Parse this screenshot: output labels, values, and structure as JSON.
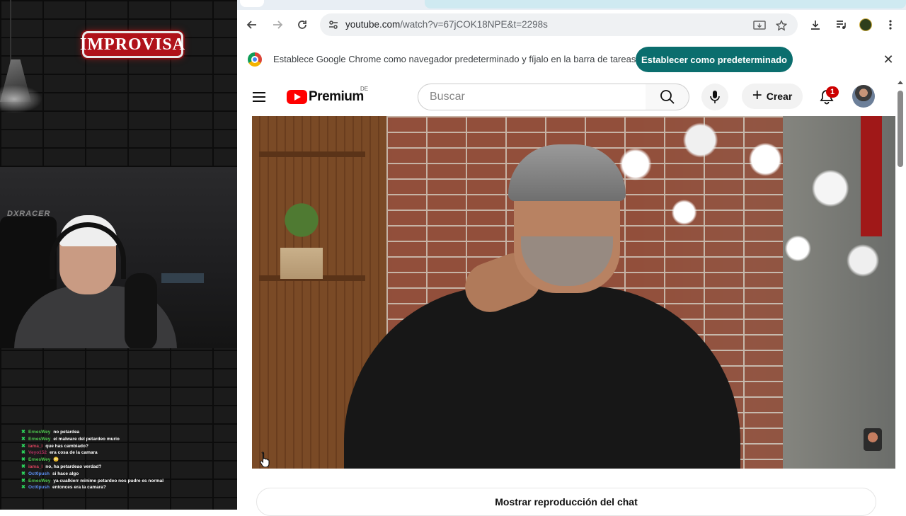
{
  "stream": {
    "brand_sign": "IMPROVISA",
    "chair_brand": "DXRACER",
    "chat": [
      {
        "user": "ErnesWey",
        "user_color": "#4ec94e",
        "text": "no petardea"
      },
      {
        "user": "ErnesWey",
        "user_color": "#4ec94e",
        "text": "el malware del petardeo murio"
      },
      {
        "user": "iama_l",
        "user_color": "#d4425b",
        "text": "que has cambiado?"
      },
      {
        "user": "Veyo152",
        "user_color": "#b03060",
        "text": "era cosa de la camara"
      },
      {
        "user": "ErnesWey",
        "user_color": "#4ec94e",
        "text": "😳"
      },
      {
        "user": "iama_l",
        "user_color": "#d4425b",
        "text": "no, ha petardeao verdad?"
      },
      {
        "user": "Oct0push",
        "user_color": "#5a8dee",
        "text": "si hace algo"
      },
      {
        "user": "ErnesWey",
        "user_color": "#4ec94e",
        "text": "ya cualkierr minime petardeo nos pudre es normal"
      },
      {
        "user": "Oct0push",
        "user_color": "#5a8dee",
        "text": "entonces era la camara?"
      }
    ]
  },
  "browser": {
    "url_host": "youtube.com",
    "url_rest": "/watch?v=67jCOK18NPE&t=2298s",
    "nav": {
      "back": "←",
      "forward": "→",
      "reload": "↻"
    },
    "infobar": {
      "message": "Establece Google Chrome como navegador predeterminado y fíjalo en la barra de tareas",
      "button": "Establecer como predeterminado",
      "close": "✕"
    }
  },
  "youtube": {
    "logo_text": "Premium",
    "region": "DE",
    "search_placeholder": "Buscar",
    "create_label": "Crear",
    "notification_count": "1",
    "chat_replay_button": "Mostrar reproducción del chat"
  },
  "colors": {
    "accent_teal": "#0b6e6e",
    "youtube_red": "#ff0000",
    "badge_red": "#cc0000"
  }
}
